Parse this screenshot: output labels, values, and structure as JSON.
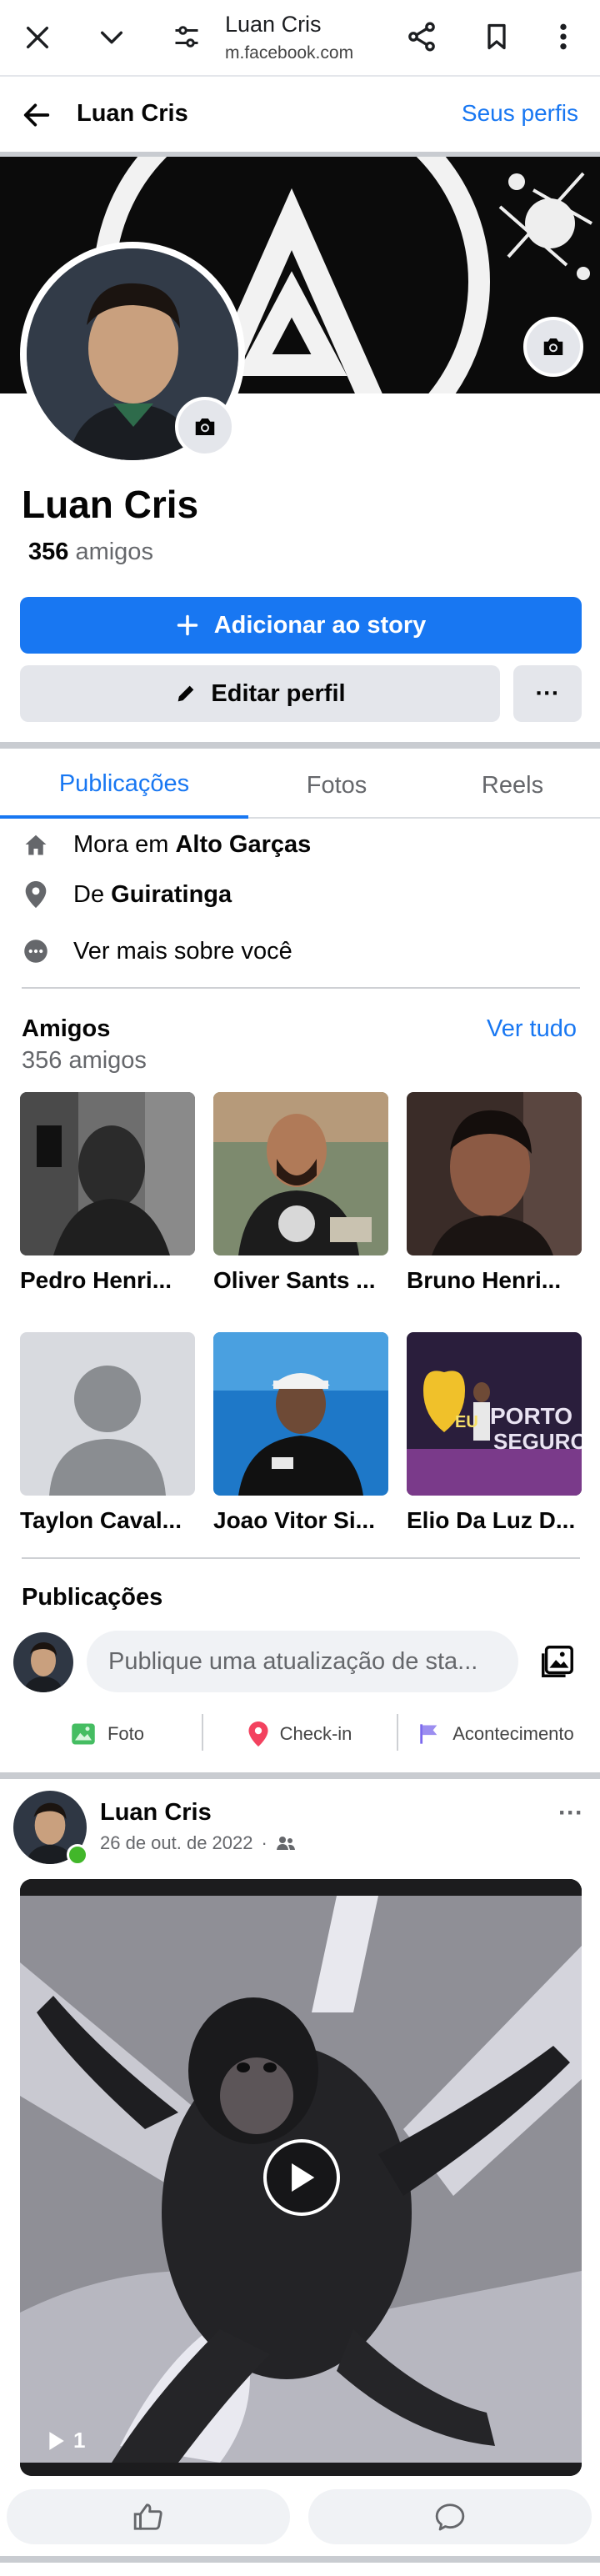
{
  "browser": {
    "title": "Luan Cris",
    "url": "m.facebook.com"
  },
  "header": {
    "name": "Luan Cris",
    "profiles_link": "Seus perfis"
  },
  "profile": {
    "name": "Luan Cris",
    "friend_count": "356",
    "friend_label": "amigos",
    "add_story_label": "Adicionar ao story",
    "edit_profile_label": "Editar perfil",
    "more_label": "···"
  },
  "tabs": [
    {
      "label": "Publicações",
      "active": true
    },
    {
      "label": "Fotos",
      "active": false
    },
    {
      "label": "Reels",
      "active": false
    }
  ],
  "about": {
    "lives_prefix": "Mora em",
    "lives_place": "Alto Garças",
    "from_prefix": "De",
    "from_place": "Guiratinga",
    "see_more": "Ver mais sobre você"
  },
  "friends": {
    "title": "Amigos",
    "count_text": "356 amigos",
    "see_all": "Ver tudo",
    "list": [
      {
        "name": "Pedro Henri..."
      },
      {
        "name": "Oliver Sants ..."
      },
      {
        "name": "Bruno Henri..."
      },
      {
        "name": "Taylon Caval..."
      },
      {
        "name": "Joao Vitor Si..."
      },
      {
        "name": "Elio Da Luz D..."
      }
    ],
    "sign_text_1": "EU",
    "sign_text_2": "PORTO",
    "sign_text_3": "SEGURO"
  },
  "posts_section": {
    "title": "Publicações",
    "composer_placeholder": "Publique uma atualização de sta...",
    "actions": [
      "Foto",
      "Check-in",
      "Acontecimento"
    ]
  },
  "post": {
    "author": "Luan Cris",
    "date": "26 de out. de 2022",
    "separator": "·",
    "menu": "···",
    "video_views": "1"
  },
  "colors": {
    "accent": "#1877f2",
    "button_grey": "#e4e6eb",
    "online": "#42b72a"
  }
}
